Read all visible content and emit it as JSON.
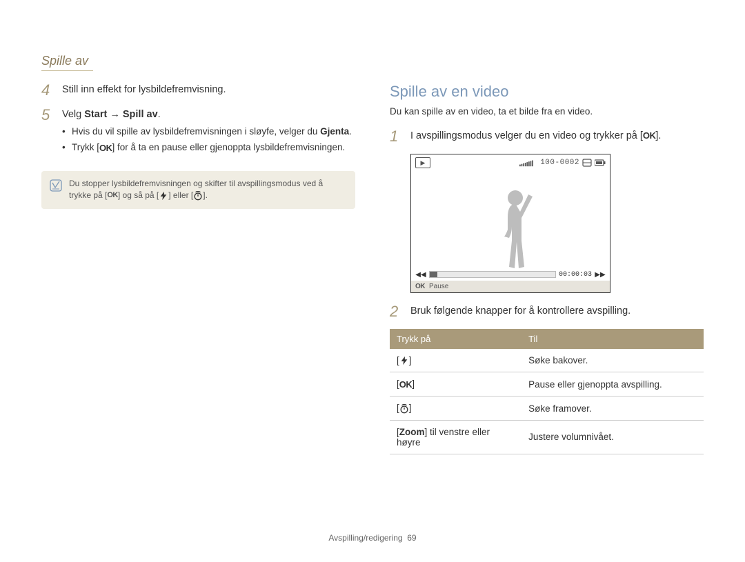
{
  "header": {
    "title": "Spille av"
  },
  "col_left": {
    "step4": "Still inn effekt for lysbildefremvisning.",
    "step5_prefix": "Velg ",
    "step5_bold1": "Start",
    "step5_arrow": " → ",
    "step5_bold2": "Spill av",
    "step5_suffix": ".",
    "bullet1_prefix": "Hvis du vil spille av lysbildefremvisningen i sløyfe, velger du ",
    "bullet1_bold": "Gjenta",
    "bullet1_suffix": ".",
    "bullet2_prefix": "Trykk [",
    "bullet2_suffix": "] for å ta en pause eller gjenoppta lysbildefremvisningen.",
    "note_prefix": "Du stopper lysbildefremvisningen og skifter til avspillingsmodus ved å trykke på [",
    "note_mid1": "] og så på [",
    "note_mid2": "] eller [",
    "note_suffix": "]."
  },
  "col_right": {
    "title": "Spille av en video",
    "subtitle": "Du kan spille av en video, ta et bilde fra en video.",
    "step1_prefix": "I avspillingsmodus velger du en video og trykker på [",
    "step1_suffix": "].",
    "step2": "Bruk følgende knapper for å kontrollere avspilling.",
    "screenshot": {
      "counter": "100-0002",
      "time": "00:00:03",
      "pause": "Pause"
    },
    "table": {
      "head_left": "Trykk på",
      "head_right": "Til",
      "rows": [
        {
          "right": "Søke bakover."
        },
        {
          "right": "Pause eller gjenoppta avspilling."
        },
        {
          "right": "Søke framover."
        },
        {
          "left_prefix": "[",
          "left_bold": "Zoom",
          "left_rest": "] til venstre eller høyre",
          "right": "Justere volumnivået."
        }
      ]
    }
  },
  "footer": {
    "text": "Avspilling/redigering",
    "page": "69"
  }
}
